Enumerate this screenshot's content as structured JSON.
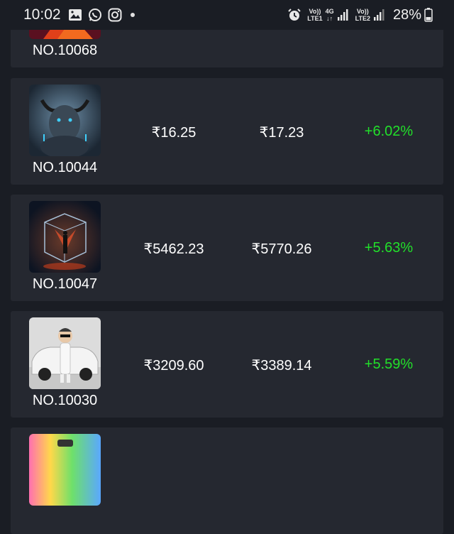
{
  "status_bar": {
    "time": "10:02",
    "sim1_top": "Vo))",
    "sim1_bottom": "LTE1",
    "network_type": "4G",
    "sim2_top": "Vo))",
    "sim2_bottom": "LTE2",
    "battery": "28%",
    "notification_icons": [
      "gallery-icon",
      "whatsapp-icon",
      "instagram-icon"
    ],
    "right_icons": [
      "alarm-icon",
      "signal-icon",
      "battery-icon"
    ]
  },
  "colors": {
    "background": "#1a1d24",
    "card": "#252830",
    "positive": "#22e02a"
  },
  "items": [
    {
      "no": "NO.10068",
      "price_a": "",
      "price_b": "",
      "change": ""
    },
    {
      "no": "NO.10044",
      "price_a": "₹16.25",
      "price_b": "₹17.23",
      "change": "+6.02%"
    },
    {
      "no": "NO.10047",
      "price_a": "₹5462.23",
      "price_b": "₹5770.26",
      "change": "+5.63%"
    },
    {
      "no": "NO.10030",
      "price_a": "₹3209.60",
      "price_b": "₹3389.14",
      "change": "+5.59%"
    },
    {
      "no": "",
      "price_a": "",
      "price_b": "",
      "change": ""
    }
  ]
}
